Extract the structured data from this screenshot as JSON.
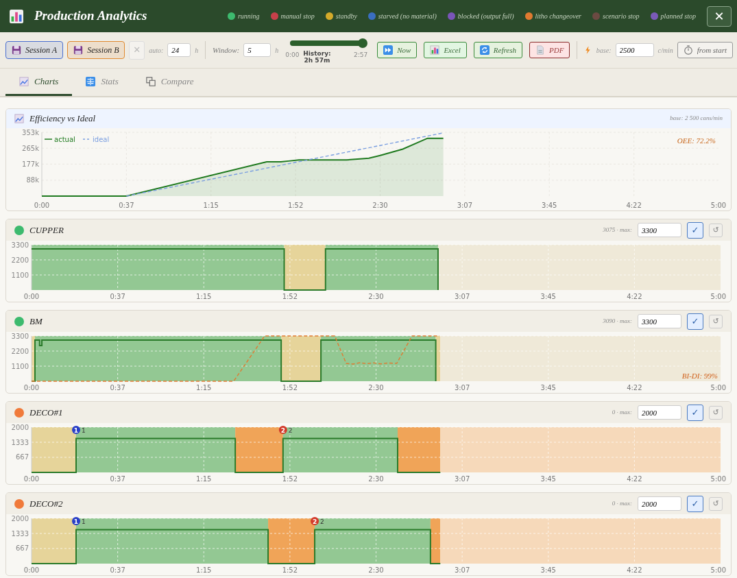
{
  "header": {
    "title": "Production Analytics",
    "close": "✕",
    "legend": [
      {
        "label": "running",
        "color": "#3dba6e"
      },
      {
        "label": "manual stop",
        "color": "#c8404a"
      },
      {
        "label": "standby",
        "color": "#d4aa2a"
      },
      {
        "label": "starved (no material)",
        "color": "#3a6ec0"
      },
      {
        "label": "blocked (output full)",
        "color": "#7a55b8"
      },
      {
        "label": "litho changeover",
        "color": "#e07a30"
      },
      {
        "label": "scenario stop",
        "color": "#6b4a42"
      },
      {
        "label": "planned stop",
        "color": "#7a5ab8"
      }
    ]
  },
  "toolbar": {
    "sessions": [
      {
        "label": "Session A",
        "color": "#4a6fd0"
      },
      {
        "label": "Session B",
        "color": "#e08a30"
      }
    ],
    "clear": {
      "label": "✕",
      "disabled": true
    },
    "auto": {
      "label": "auto:",
      "value": "24",
      "unit": "h"
    },
    "window": {
      "label": "Window:",
      "value": "5",
      "unit": "h"
    },
    "history": {
      "level": 1,
      "start": "0:00",
      "label": "History: 2h 57m",
      "end": "2:57"
    },
    "actions": [
      {
        "label": "Now",
        "kind": "now"
      },
      {
        "label": "Excel",
        "kind": "excel"
      },
      {
        "label": "Refresh",
        "kind": "refresh"
      },
      {
        "label": "PDF",
        "kind": "pdf"
      }
    ],
    "base": {
      "label": "base:",
      "value": "2500",
      "unit": "c/min"
    },
    "from_start": "from start"
  },
  "tabs": [
    {
      "label": "Charts",
      "kind": "charts",
      "selected": true
    },
    {
      "label": "Stats",
      "kind": "stats",
      "selected": false
    },
    {
      "label": "Compare",
      "kind": "compare",
      "selected": false
    }
  ],
  "efficiency": {
    "title": "Efficiency vs Ideal",
    "note": "base: 2 500 cans/min",
    "oee": "OEE: 72.2%",
    "chart_data": {
      "type": "line",
      "grid": true,
      "legend": "upper left",
      "xlim": [
        0,
        300
      ],
      "ylim": [
        0,
        353000
      ],
      "xticks": [
        {
          "value": 0,
          "label": "0:00"
        },
        {
          "value": 37.5,
          "label": "0:37"
        },
        {
          "value": 75,
          "label": "1:15"
        },
        {
          "value": 112.5,
          "label": "1:52"
        },
        {
          "value": 150,
          "label": "2:30"
        },
        {
          "value": 187.5,
          "label": "3:07"
        },
        {
          "value": 225,
          "label": "3:45"
        },
        {
          "value": 262.5,
          "label": "4:22"
        },
        {
          "value": 300,
          "label": "5:00"
        }
      ],
      "yticks": [
        {
          "value": 88000,
          "label": "88k"
        },
        {
          "value": 177000,
          "label": "177k"
        },
        {
          "value": 265000,
          "label": "265k"
        },
        {
          "value": 353000,
          "label": "353k"
        }
      ],
      "series": [
        {
          "name": "actual",
          "type": "area",
          "color": "#1f7a1f",
          "x": [
            0,
            37.5,
            99.7,
            104,
            106,
            110,
            114,
            125,
            135,
            140,
            145,
            150,
            160,
            171,
            178
          ],
          "values": [
            0,
            0,
            190000,
            190000,
            190000,
            195000,
            200000,
            200000,
            200000,
            205000,
            210000,
            225000,
            260000,
            320000,
            320000
          ]
        },
        {
          "name": "ideal",
          "color": "#7a9ee0",
          "line_style": "dashed",
          "x": [
            37.5,
            178
          ],
          "values": [
            0,
            350000
          ]
        }
      ]
    }
  },
  "machines": [
    {
      "name": "CUPPER",
      "color": "#3dba6e",
      "reading": "3075 · max:",
      "max": "3300",
      "apply": "✓",
      "reset": "↺",
      "chart_data": {
        "type": "line",
        "grid": true,
        "xlim": [
          0,
          300
        ],
        "ylim": [
          0,
          3300
        ],
        "xticks": [
          {
            "value": 0,
            "label": "0:00"
          },
          {
            "value": 37.5,
            "label": "0:37"
          },
          {
            "value": 75,
            "label": "1:15"
          },
          {
            "value": 112.5,
            "label": "1:52"
          },
          {
            "value": 150,
            "label": "2:30"
          },
          {
            "value": 187.5,
            "label": "3:07"
          },
          {
            "value": 225,
            "label": "3:45"
          },
          {
            "value": 262.5,
            "label": "4:22"
          },
          {
            "value": 300,
            "label": "5:00"
          }
        ],
        "yticks": [
          1100,
          2200,
          3300
        ],
        "series": [
          {
            "color": "#2a7a2a",
            "x": [
              0,
              110,
              110,
              128,
              128,
              177,
              177
            ],
            "values": [
              3000,
              3000,
              0,
              0,
              3000,
              3000,
              0
            ]
          }
        ],
        "bands": [
          {
            "axis": "x",
            "from": 0,
            "to": 110,
            "color": "#93c893"
          },
          {
            "axis": "x",
            "from": 110,
            "to": 128,
            "color": "#e6d49a"
          },
          {
            "axis": "x",
            "from": 128,
            "to": 177,
            "color": "#93c893"
          },
          {
            "axis": "x",
            "from": 177,
            "to": 300,
            "color": "#efe9d8"
          }
        ]
      }
    },
    {
      "name": "BM",
      "color": "#3dba6e",
      "reading": "3090 · max:",
      "max": "3300",
      "apply": "✓",
      "reset": "↺",
      "ratio": "BI-DI: 99%",
      "chart_data": {
        "type": "line",
        "grid": true,
        "xlim": [
          0,
          300
        ],
        "ylim": [
          0,
          3300
        ],
        "xticks": [
          {
            "value": 0,
            "label": "0:00"
          },
          {
            "value": 37.5,
            "label": "0:37"
          },
          {
            "value": 75,
            "label": "1:15"
          },
          {
            "value": 112.5,
            "label": "1:52"
          },
          {
            "value": 150,
            "label": "2:30"
          },
          {
            "value": 187.5,
            "label": "3:07"
          },
          {
            "value": 225,
            "label": "3:45"
          },
          {
            "value": 262.5,
            "label": "4:22"
          },
          {
            "value": 300,
            "label": "5:00"
          }
        ],
        "yticks": [
          1100,
          2200,
          3300
        ],
        "series": [
          {
            "color": "#2a7a2a",
            "x": [
              0,
              1.5,
              1.5,
              3.5,
              3.5,
              4.5,
              4.5,
              108.7,
              108.7,
              126,
              126,
              176,
              176
            ],
            "values": [
              0,
              0,
              3000,
              3000,
              2600,
              2600,
              3000,
              3000,
              0,
              0,
              3000,
              3000,
              0
            ]
          },
          {
            "color": "#e07a30",
            "line_style": "dashed",
            "x": [
              0,
              88,
              101.5,
              132,
              137,
              140,
              143,
              146,
              149,
              152,
              155,
              159,
              165.7,
              177.6
            ],
            "values": [
              0,
              0,
              3300,
              3300,
              1300,
              1250,
              1350,
              1280,
              1340,
              1260,
              1330,
              1300,
              3300,
              3300
            ]
          }
        ],
        "bands": [
          {
            "axis": "x",
            "from": 0,
            "to": 1.5,
            "color": "#e6d49a"
          },
          {
            "axis": "x",
            "from": 1.5,
            "to": 108.7,
            "color": "#93c893"
          },
          {
            "axis": "x",
            "from": 108.7,
            "to": 126,
            "color": "#e6d49a"
          },
          {
            "axis": "x",
            "from": 126,
            "to": 176,
            "color": "#93c893"
          },
          {
            "axis": "x",
            "from": 176,
            "to": 178,
            "color": "#e6d49a"
          },
          {
            "axis": "x",
            "from": 178,
            "to": 300,
            "color": "#efe9d8"
          }
        ]
      }
    },
    {
      "name": "DECO#1",
      "color": "#f07a3a",
      "reading": "0 · max:",
      "max": "2000",
      "apply": "✓",
      "reset": "↺",
      "events": [
        {
          "label": "1",
          "color": "#2a3fc8"
        },
        {
          "label": "2",
          "color": "#d23a2a"
        }
      ],
      "chart_data": {
        "type": "line",
        "grid": true,
        "xlim": [
          0,
          300
        ],
        "ylim": [
          0,
          2000
        ],
        "xticks": [
          {
            "value": 0,
            "label": "0:00"
          },
          {
            "value": 37.5,
            "label": "0:37"
          },
          {
            "value": 75,
            "label": "1:15"
          },
          {
            "value": 112.5,
            "label": "1:52"
          },
          {
            "value": 150,
            "label": "2:30"
          },
          {
            "value": 187.5,
            "label": "3:07"
          },
          {
            "value": 225,
            "label": "3:45"
          },
          {
            "value": 262.5,
            "label": "4:22"
          },
          {
            "value": 300,
            "label": "5:00"
          }
        ],
        "yticks": [
          667,
          1333,
          2000
        ],
        "series": [
          {
            "color": "#2a7a2a",
            "x": [
              0,
              19.4,
              19.4,
              88.7,
              88.7,
              109.5,
              109.5,
              159.4,
              159.4,
              178
            ],
            "values": [
              0,
              0,
              1500,
              1500,
              0,
              0,
              1500,
              1500,
              0,
              0
            ]
          }
        ],
        "bands": [
          {
            "axis": "x",
            "from": 0,
            "to": 19.4,
            "color": "#e6d49a"
          },
          {
            "axis": "x",
            "from": 19.4,
            "to": 88.7,
            "color": "#93c893"
          },
          {
            "axis": "x",
            "from": 88.7,
            "to": 109.5,
            "color": "#f0a458"
          },
          {
            "axis": "x",
            "from": 109.5,
            "to": 159.4,
            "color": "#93c893"
          },
          {
            "axis": "x",
            "from": 159.4,
            "to": 178,
            "color": "#f0a458"
          },
          {
            "axis": "x",
            "from": 178,
            "to": 300,
            "color": "#f6d9ba"
          }
        ],
        "annotations": [
          {
            "x": 19.4,
            "y": 2000,
            "text": "1"
          },
          {
            "x": 109.5,
            "y": 2000,
            "text": "2"
          }
        ]
      }
    },
    {
      "name": "DECO#2",
      "color": "#f07a3a",
      "reading": "0 · max:",
      "max": "2000",
      "apply": "✓",
      "reset": "↺",
      "events": [
        {
          "label": "1",
          "color": "#2a3fc8"
        },
        {
          "label": "2",
          "color": "#d23a2a"
        }
      ],
      "chart_data": {
        "type": "line",
        "grid": true,
        "xlim": [
          0,
          300
        ],
        "ylim": [
          0,
          2000
        ],
        "xticks": [
          {
            "value": 0,
            "label": "0:00"
          },
          {
            "value": 37.5,
            "label": "0:37"
          },
          {
            "value": 75,
            "label": "1:15"
          },
          {
            "value": 112.5,
            "label": "1:52"
          },
          {
            "value": 150,
            "label": "2:30"
          },
          {
            "value": 187.5,
            "label": "3:07"
          },
          {
            "value": 225,
            "label": "3:45"
          },
          {
            "value": 262.5,
            "label": "4:22"
          },
          {
            "value": 300,
            "label": "5:00"
          }
        ],
        "yticks": [
          667,
          1333,
          2000
        ],
        "series": [
          {
            "color": "#2a7a2a",
            "x": [
              0,
              19.4,
              19.4,
              103,
              103,
              123.3,
              123.3,
              173.7,
              173.7,
              178
            ],
            "values": [
              0,
              0,
              1500,
              1500,
              0,
              0,
              1500,
              1500,
              0,
              0
            ]
          }
        ],
        "bands": [
          {
            "axis": "x",
            "from": 0,
            "to": 19.4,
            "color": "#e6d49a"
          },
          {
            "axis": "x",
            "from": 19.4,
            "to": 103,
            "color": "#93c893"
          },
          {
            "axis": "x",
            "from": 103,
            "to": 123.3,
            "color": "#f0a458"
          },
          {
            "axis": "x",
            "from": 123.3,
            "to": 173.7,
            "color": "#93c893"
          },
          {
            "axis": "x",
            "from": 173.7,
            "to": 178,
            "color": "#f0a458"
          },
          {
            "axis": "x",
            "from": 178,
            "to": 300,
            "color": "#f6d9ba"
          }
        ],
        "annotations": [
          {
            "x": 19.4,
            "y": 2000,
            "text": "1"
          },
          {
            "x": 123.3,
            "y": 2000,
            "text": "2"
          }
        ]
      }
    }
  ]
}
